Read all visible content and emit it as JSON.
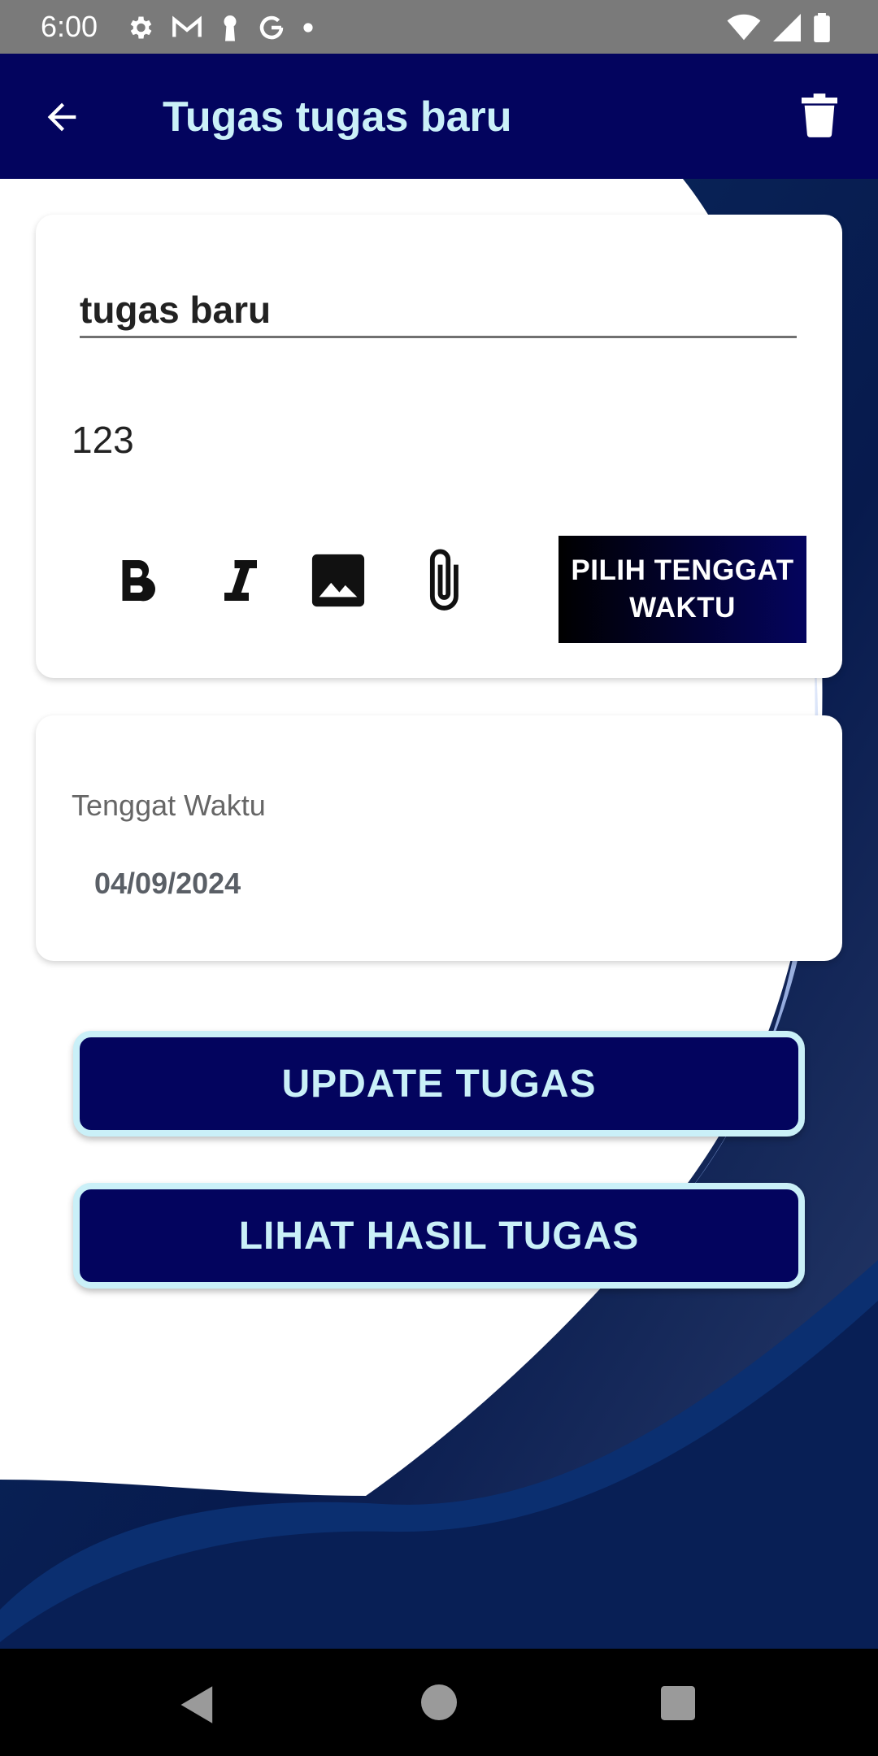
{
  "status_bar": {
    "time": "6:00",
    "left_icons": [
      "settings-icon",
      "gmail-icon",
      "keyhole-icon",
      "google-icon",
      "dot-icon"
    ],
    "right_icons": [
      "wifi-icon",
      "signal-icon",
      "battery-icon"
    ]
  },
  "app_bar": {
    "title": "Tugas tugas baru",
    "back_icon": "arrow-back-icon",
    "delete_icon": "trash-icon"
  },
  "editor": {
    "title_value": "tugas baru",
    "content_value": "123",
    "toolbar": [
      "bold-icon",
      "italic-icon",
      "image-icon",
      "attachment-icon"
    ],
    "pick_deadline_label": "PILIH TENGGAT WAKTU"
  },
  "deadline": {
    "label": "Tenggat Waktu",
    "value": "04/09/2024"
  },
  "actions": {
    "update_label": "UPDATE TUGAS",
    "view_results_label": "LIHAT HASIL TUGAS"
  },
  "colors": {
    "primary": "#03045e",
    "accent_light": "#caf0f8",
    "wave_dark": "#0a2a66"
  },
  "nav_bar": {
    "icons": [
      "nav-back-icon",
      "nav-home-icon",
      "nav-recent-icon"
    ]
  }
}
